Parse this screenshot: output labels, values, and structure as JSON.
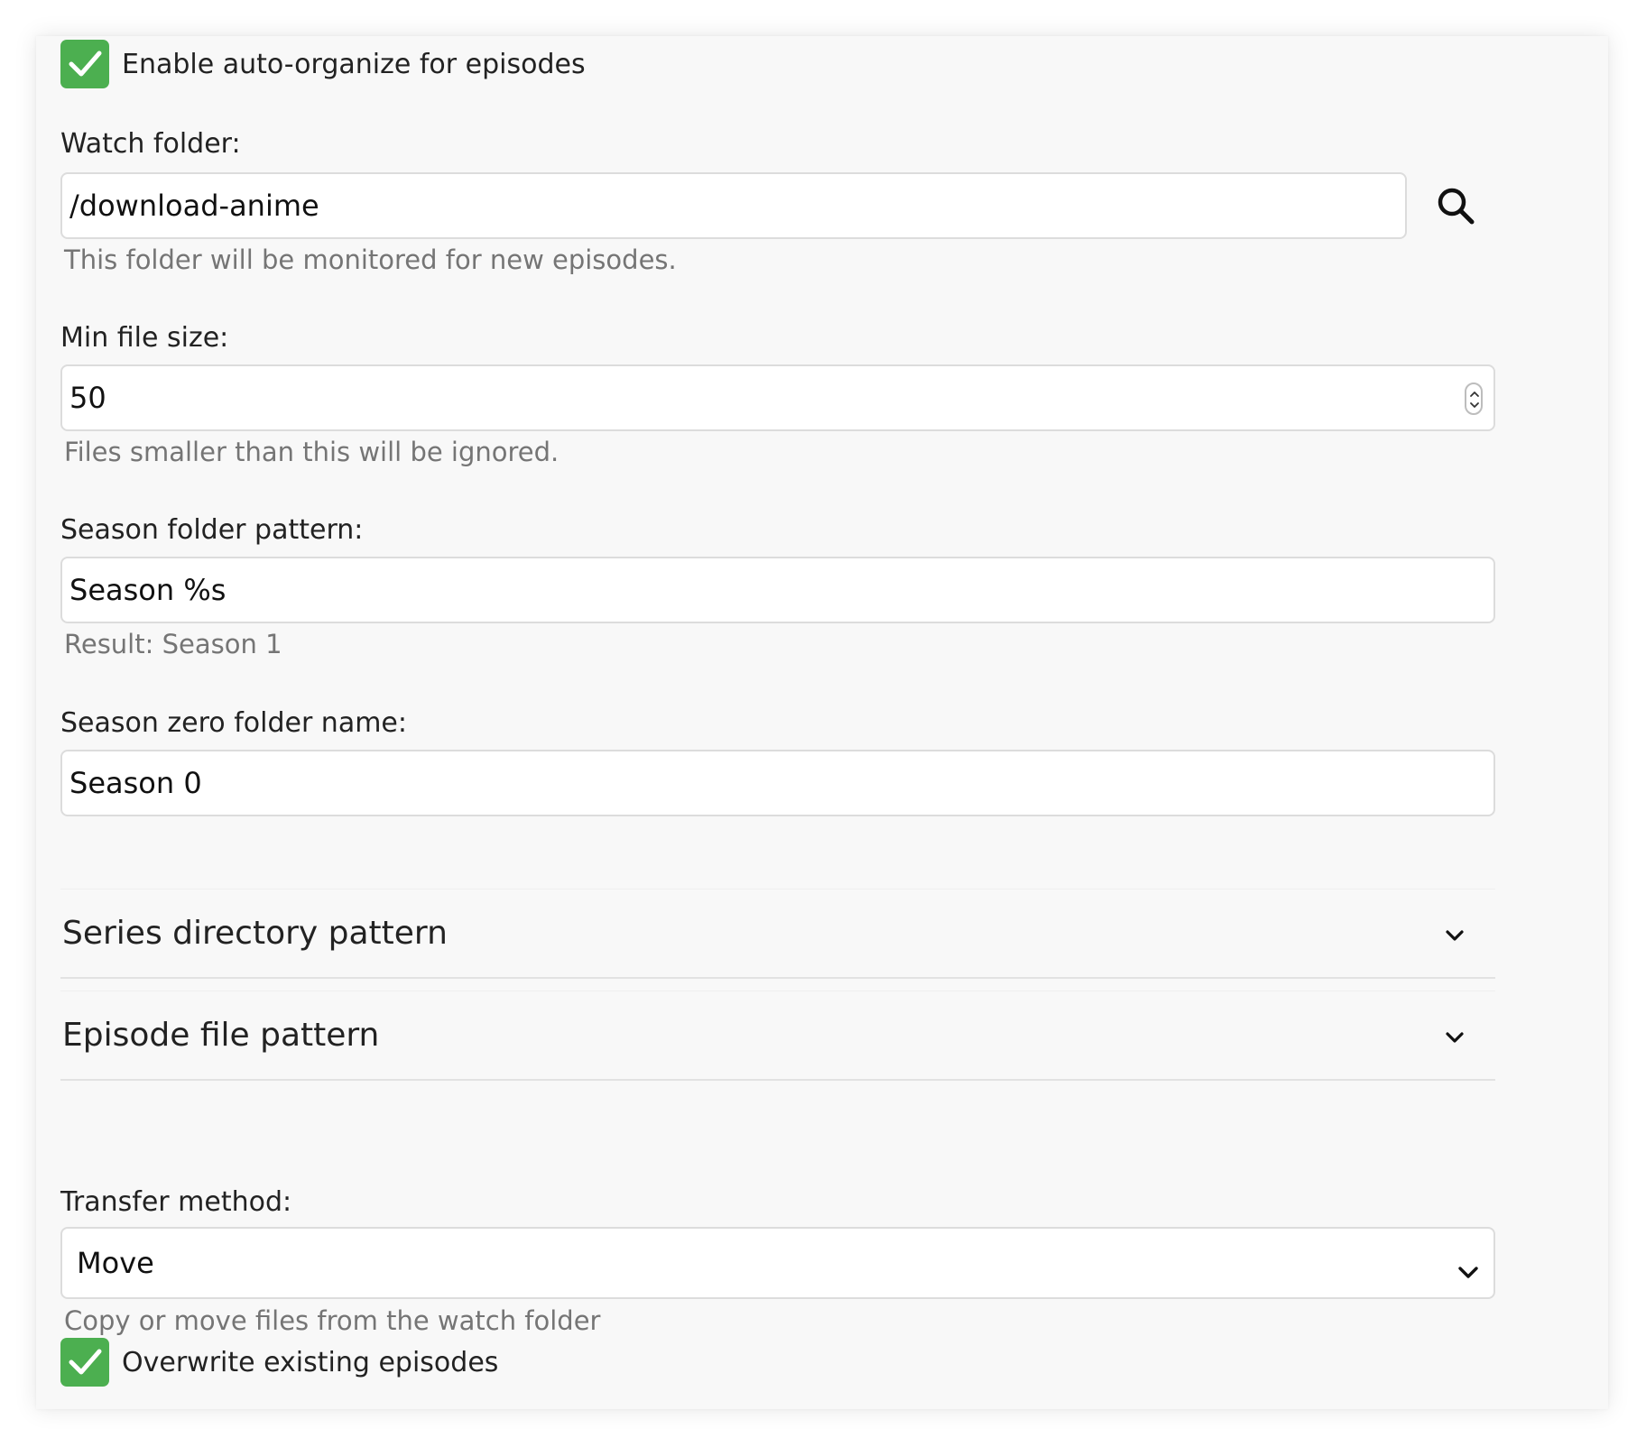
{
  "auto_organize": {
    "label": "Enable auto-organize for episodes",
    "checked": true
  },
  "watch_folder": {
    "label": "Watch folder:",
    "value": "/download-anime",
    "helper": "This folder will be monitored for new episodes."
  },
  "min_file_size": {
    "label": "Min file size:",
    "value": "50",
    "helper": "Files smaller than this will be ignored."
  },
  "season_folder_pattern": {
    "label": "Season folder pattern:",
    "value": "Season %s",
    "helper": "Result: Season 1"
  },
  "season_zero_folder_name": {
    "label": "Season zero folder name:",
    "value": "Season 0"
  },
  "sections": [
    {
      "title": "Series directory pattern"
    },
    {
      "title": "Episode file pattern"
    }
  ],
  "transfer_method": {
    "label": "Transfer method:",
    "selected": "Move",
    "helper": "Copy or move files from the watch folder"
  },
  "overwrite": {
    "label": "Overwrite existing episodes",
    "checked": true
  },
  "colors": {
    "checkbox": "#4caf50",
    "background": "#f8f8f8",
    "helper_text": "#757575"
  },
  "icons": [
    "check-icon",
    "search-icon",
    "spinner-arrows-icon",
    "chevron-down-icon"
  ]
}
